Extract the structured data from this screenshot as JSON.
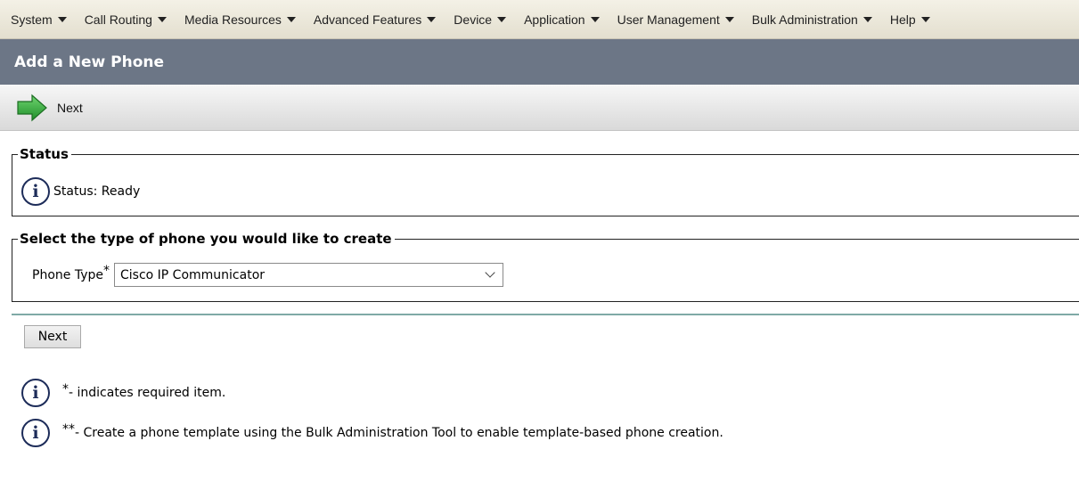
{
  "menu": [
    {
      "label": "System"
    },
    {
      "label": "Call Routing"
    },
    {
      "label": "Media Resources"
    },
    {
      "label": "Advanced Features"
    },
    {
      "label": "Device"
    },
    {
      "label": "Application"
    },
    {
      "label": "User Management"
    },
    {
      "label": "Bulk Administration"
    },
    {
      "label": "Help"
    }
  ],
  "page": {
    "title": "Add a New Phone"
  },
  "toolbar": {
    "next_label": "Next",
    "next_icon": "green-arrow-right-icon"
  },
  "status_section": {
    "legend": "Status",
    "text": "Status: Ready",
    "icon": "info-icon"
  },
  "phone_section": {
    "legend": "Select the type of phone you would like to create",
    "label": "Phone Type",
    "required_mark": "*",
    "selected": "Cisco IP Communicator"
  },
  "next_button": {
    "label": "Next"
  },
  "notes": [
    {
      "marker": "*",
      "text": "- indicates required item."
    },
    {
      "marker": "**",
      "text": "- Create a phone template using the Bulk Administration Tool to enable template-based phone creation."
    }
  ],
  "colors": {
    "titlebar": "#6c7686",
    "arrow": "#2fa83a",
    "divider": "#7fa9a6",
    "info": "#1d2c59"
  }
}
